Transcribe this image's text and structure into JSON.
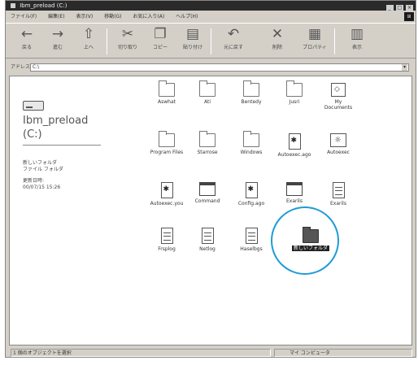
{
  "window": {
    "title": "Ibm_preload (C:)",
    "controls": [
      "_",
      "□",
      "×"
    ]
  },
  "menubar": {
    "items": [
      "ファイル(F)",
      "編集(E)",
      "表示(V)",
      "移動(G)",
      "お気に入り(A)",
      "ヘルプ(H)"
    ],
    "throbber": "⊞"
  },
  "toolbar": {
    "buttons": [
      {
        "icon": "back-arrow-icon",
        "glyph": "←",
        "label": "戻る"
      },
      {
        "icon": "forward-arrow-icon",
        "glyph": "→",
        "label": "進む"
      },
      {
        "icon": "up-folder-icon",
        "glyph": "⇧",
        "label": "上へ"
      },
      {
        "icon": "cut-icon",
        "glyph": "✂",
        "label": "切り取り"
      },
      {
        "icon": "copy-icon",
        "glyph": "❐",
        "label": "コピー"
      },
      {
        "icon": "paste-icon",
        "glyph": "▤",
        "label": "貼り付け"
      },
      {
        "icon": "undo-icon",
        "glyph": "↶",
        "label": "元に戻す"
      },
      {
        "icon": "delete-icon",
        "glyph": "✕",
        "label": "削除"
      },
      {
        "icon": "properties-icon",
        "glyph": "▦",
        "label": "プロパティ"
      },
      {
        "icon": "views-icon",
        "glyph": "▥",
        "label": "表示"
      }
    ]
  },
  "address": {
    "label": "アドレス",
    "value": "C:\\",
    "dropdown": "▾"
  },
  "left_panel": {
    "drive_name": "Ibm_preload",
    "drive_letter": "(C:)",
    "lines": [
      "新しいフォルダ",
      "ファイル フォルダ",
      "更新日時:",
      "00/07/15 15:26"
    ]
  },
  "files": [
    {
      "name": "Aswhat",
      "type": "folder"
    },
    {
      "name": "Ati",
      "type": "folder"
    },
    {
      "name": "Bentedy",
      "type": "folder"
    },
    {
      "name": "Jusri",
      "type": "folder"
    },
    {
      "name": "My Documents",
      "type": "mydocs"
    },
    {
      "name": "Program Files",
      "type": "folder"
    },
    {
      "name": "Starrose",
      "type": "folder"
    },
    {
      "name": "Windows",
      "type": "folder"
    },
    {
      "name": "Autoexec.ago",
      "type": "doc"
    },
    {
      "name": "Autoexec",
      "type": "setup"
    },
    {
      "name": "Autoexec.you",
      "type": "doc"
    },
    {
      "name": "Command",
      "type": "window"
    },
    {
      "name": "Config.ago",
      "type": "doc"
    },
    {
      "name": "Exarils",
      "type": "window"
    },
    {
      "name": "Exarils",
      "type": "txt"
    },
    {
      "name": "Frsplog",
      "type": "txt"
    },
    {
      "name": "Netlog",
      "type": "txt"
    },
    {
      "name": "Haselbgs",
      "type": "txt"
    },
    {
      "name": "新しいフォルダ",
      "type": "folder-selected"
    }
  ],
  "statusbar": {
    "left": "1 個のオブジェクトを選択",
    "right": "マイ コンピュータ"
  },
  "colors": {
    "highlight_circle": "#1e9bd7",
    "window_face": "#d4d0c8"
  }
}
